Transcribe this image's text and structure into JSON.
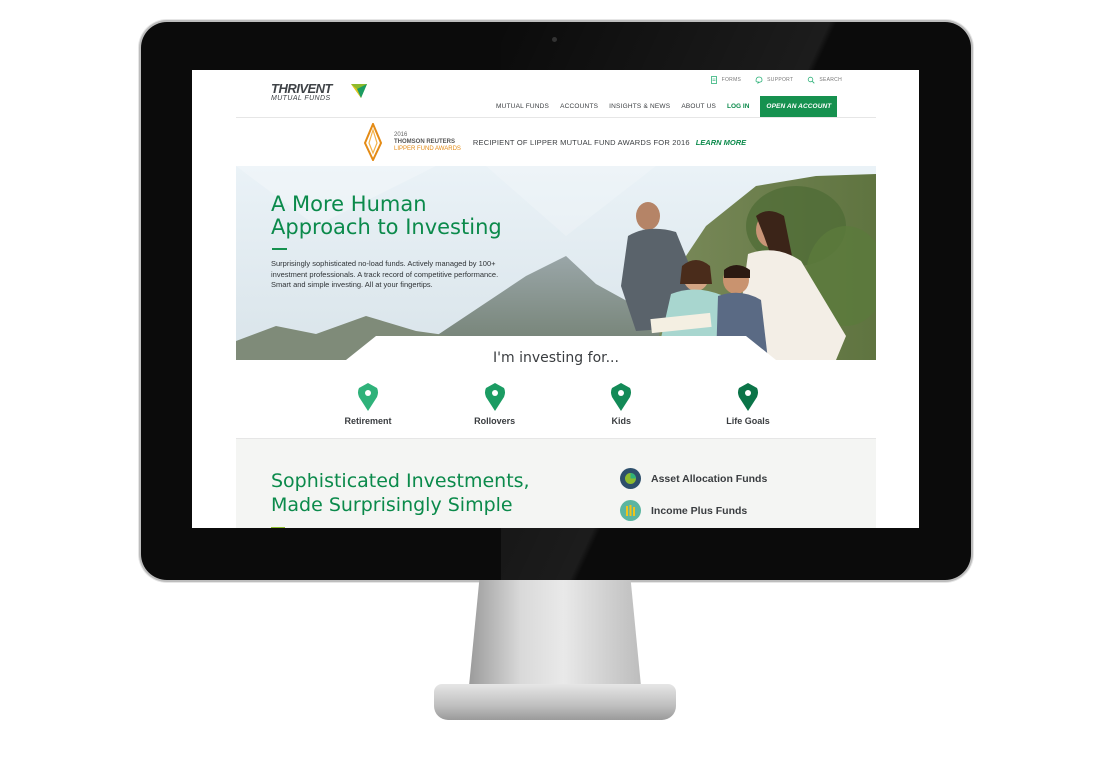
{
  "utility_nav": [
    {
      "label": "FORMS",
      "icon": "forms-icon"
    },
    {
      "label": "SUPPORT",
      "icon": "support-icon"
    },
    {
      "label": "SEARCH",
      "icon": "search-icon"
    }
  ],
  "logo": {
    "name": "THRIVENT",
    "sub": "MUTUAL FUNDS"
  },
  "main_nav": {
    "links": [
      "MUTUAL FUNDS",
      "ACCOUNTS",
      "INSIGHTS & NEWS",
      "ABOUT US"
    ],
    "login": "LOG IN",
    "cta": "OPEN AN ACCOUNT"
  },
  "award": {
    "year": "2016",
    "line1": "THOMSON REUTERS",
    "line2": "LIPPER FUND AWARDS",
    "message": "RECIPIENT OF LIPPER MUTUAL FUND AWARDS FOR 2016",
    "link": "LEARN MORE"
  },
  "hero": {
    "title_line1": "A More Human",
    "title_line2": "Approach to Investing",
    "body": "Surprisingly sophisticated no-load funds. Actively managed by 100+ investment professionals. A track record of competitive performance. Smart and simple investing. All at your fingertips."
  },
  "investing_for": {
    "title": "I'm investing for...",
    "items": [
      {
        "label": "Retirement",
        "color": "#2fb27a"
      },
      {
        "label": "Rollovers",
        "color": "#1b9c63"
      },
      {
        "label": "Kids",
        "color": "#138a57"
      },
      {
        "label": "Life Goals",
        "color": "#0b7448"
      }
    ]
  },
  "lower": {
    "title_line1": "Sophisticated Investments,",
    "title_line2": "Made Surprisingly Simple",
    "funds": [
      {
        "label": "Asset Allocation Funds",
        "icon": "pie-chart-icon"
      },
      {
        "label": "Income Plus Funds",
        "icon": "bars-icon"
      }
    ]
  },
  "colors": {
    "brand_green": "#0b8a4b",
    "cta_green": "#16914f",
    "award_orange": "#e48b15"
  }
}
